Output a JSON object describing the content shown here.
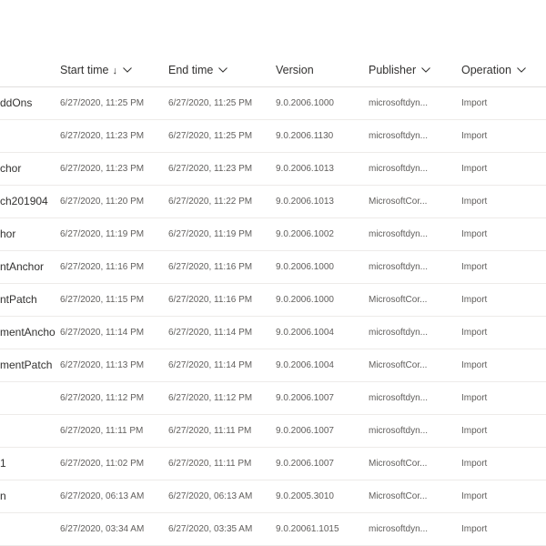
{
  "columns": [
    {
      "key": "start_time",
      "label": "Start time",
      "sorted": "↓"
    },
    {
      "key": "end_time",
      "label": "End time"
    },
    {
      "key": "version",
      "label": "Version"
    },
    {
      "key": "publisher",
      "label": "Publisher"
    },
    {
      "key": "operation",
      "label": "Operation"
    }
  ],
  "rows": [
    {
      "name": "ddOns",
      "start": "6/27/2020, 11:25 PM",
      "end": "6/27/2020, 11:25 PM",
      "version": "9.0.2006.1000",
      "publisher": "microsoftdyn...",
      "operation": "Import"
    },
    {
      "name": "",
      "start": "6/27/2020, 11:23 PM",
      "end": "6/27/2020, 11:25 PM",
      "version": "9.0.2006.1130",
      "publisher": "microsoftdyn...",
      "operation": "Import"
    },
    {
      "name": "chor",
      "start": "6/27/2020, 11:23 PM",
      "end": "6/27/2020, 11:23 PM",
      "version": "9.0.2006.1013",
      "publisher": "microsoftdyn...",
      "operation": "Import"
    },
    {
      "name": "ch201904",
      "start": "6/27/2020, 11:20 PM",
      "end": "6/27/2020, 11:22 PM",
      "version": "9.0.2006.1013",
      "publisher": "MicrosoftCor...",
      "operation": "Import"
    },
    {
      "name": "hor",
      "start": "6/27/2020, 11:19 PM",
      "end": "6/27/2020, 11:19 PM",
      "version": "9.0.2006.1002",
      "publisher": "microsoftdyn...",
      "operation": "Import"
    },
    {
      "name": "ntAnchor",
      "start": "6/27/2020, 11:16 PM",
      "end": "6/27/2020, 11:16 PM",
      "version": "9.0.2006.1000",
      "publisher": "microsoftdyn...",
      "operation": "Import"
    },
    {
      "name": "ntPatch",
      "start": "6/27/2020, 11:15 PM",
      "end": "6/27/2020, 11:16 PM",
      "version": "9.0.2006.1000",
      "publisher": "MicrosoftCor...",
      "operation": "Import"
    },
    {
      "name": "mentAncho",
      "start": "6/27/2020, 11:14 PM",
      "end": "6/27/2020, 11:14 PM",
      "version": "9.0.2006.1004",
      "publisher": "microsoftdyn...",
      "operation": "Import"
    },
    {
      "name": "mentPatch",
      "start": "6/27/2020, 11:13 PM",
      "end": "6/27/2020, 11:14 PM",
      "version": "9.0.2006.1004",
      "publisher": "MicrosoftCor...",
      "operation": "Import"
    },
    {
      "name": "",
      "start": "6/27/2020, 11:12 PM",
      "end": "6/27/2020, 11:12 PM",
      "version": "9.0.2006.1007",
      "publisher": "microsoftdyn...",
      "operation": "Import"
    },
    {
      "name": "",
      "start": "6/27/2020, 11:11 PM",
      "end": "6/27/2020, 11:11 PM",
      "version": "9.0.2006.1007",
      "publisher": "microsoftdyn...",
      "operation": "Import"
    },
    {
      "name": "1",
      "start": "6/27/2020, 11:02 PM",
      "end": "6/27/2020, 11:11 PM",
      "version": "9.0.2006.1007",
      "publisher": "MicrosoftCor...",
      "operation": "Import"
    },
    {
      "name": "n",
      "start": "6/27/2020, 06:13 AM",
      "end": "6/27/2020, 06:13 AM",
      "version": "9.0.2005.3010",
      "publisher": "MicrosoftCor...",
      "operation": "Import"
    },
    {
      "name": "",
      "start": "6/27/2020, 03:34 AM",
      "end": "6/27/2020, 03:35 AM",
      "version": "9.0.20061.1015",
      "publisher": "microsoftdyn...",
      "operation": "Import"
    }
  ]
}
